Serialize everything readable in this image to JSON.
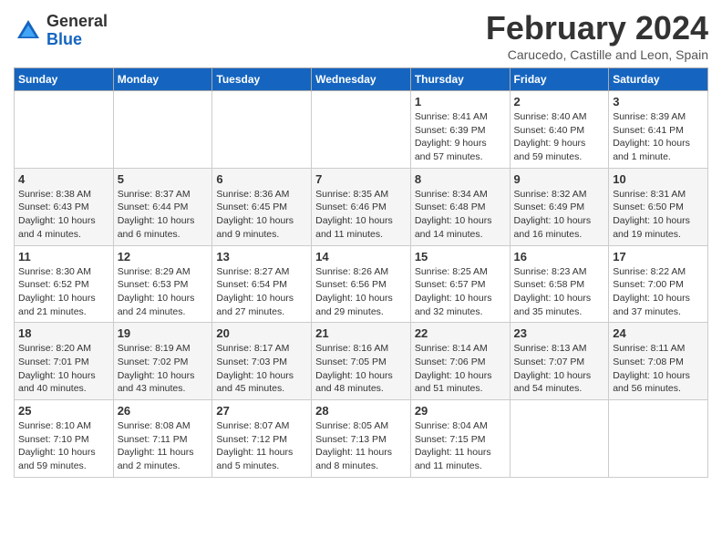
{
  "logo": {
    "general": "General",
    "blue": "Blue"
  },
  "title": "February 2024",
  "location": "Carucedo, Castille and Leon, Spain",
  "weekdays": [
    "Sunday",
    "Monday",
    "Tuesday",
    "Wednesday",
    "Thursday",
    "Friday",
    "Saturday"
  ],
  "weeks": [
    [
      {
        "day": "",
        "info": ""
      },
      {
        "day": "",
        "info": ""
      },
      {
        "day": "",
        "info": ""
      },
      {
        "day": "",
        "info": ""
      },
      {
        "day": "1",
        "info": "Sunrise: 8:41 AM\nSunset: 6:39 PM\nDaylight: 9 hours\nand 57 minutes."
      },
      {
        "day": "2",
        "info": "Sunrise: 8:40 AM\nSunset: 6:40 PM\nDaylight: 9 hours\nand 59 minutes."
      },
      {
        "day": "3",
        "info": "Sunrise: 8:39 AM\nSunset: 6:41 PM\nDaylight: 10 hours\nand 1 minute."
      }
    ],
    [
      {
        "day": "4",
        "info": "Sunrise: 8:38 AM\nSunset: 6:43 PM\nDaylight: 10 hours\nand 4 minutes."
      },
      {
        "day": "5",
        "info": "Sunrise: 8:37 AM\nSunset: 6:44 PM\nDaylight: 10 hours\nand 6 minutes."
      },
      {
        "day": "6",
        "info": "Sunrise: 8:36 AM\nSunset: 6:45 PM\nDaylight: 10 hours\nand 9 minutes."
      },
      {
        "day": "7",
        "info": "Sunrise: 8:35 AM\nSunset: 6:46 PM\nDaylight: 10 hours\nand 11 minutes."
      },
      {
        "day": "8",
        "info": "Sunrise: 8:34 AM\nSunset: 6:48 PM\nDaylight: 10 hours\nand 14 minutes."
      },
      {
        "day": "9",
        "info": "Sunrise: 8:32 AM\nSunset: 6:49 PM\nDaylight: 10 hours\nand 16 minutes."
      },
      {
        "day": "10",
        "info": "Sunrise: 8:31 AM\nSunset: 6:50 PM\nDaylight: 10 hours\nand 19 minutes."
      }
    ],
    [
      {
        "day": "11",
        "info": "Sunrise: 8:30 AM\nSunset: 6:52 PM\nDaylight: 10 hours\nand 21 minutes."
      },
      {
        "day": "12",
        "info": "Sunrise: 8:29 AM\nSunset: 6:53 PM\nDaylight: 10 hours\nand 24 minutes."
      },
      {
        "day": "13",
        "info": "Sunrise: 8:27 AM\nSunset: 6:54 PM\nDaylight: 10 hours\nand 27 minutes."
      },
      {
        "day": "14",
        "info": "Sunrise: 8:26 AM\nSunset: 6:56 PM\nDaylight: 10 hours\nand 29 minutes."
      },
      {
        "day": "15",
        "info": "Sunrise: 8:25 AM\nSunset: 6:57 PM\nDaylight: 10 hours\nand 32 minutes."
      },
      {
        "day": "16",
        "info": "Sunrise: 8:23 AM\nSunset: 6:58 PM\nDaylight: 10 hours\nand 35 minutes."
      },
      {
        "day": "17",
        "info": "Sunrise: 8:22 AM\nSunset: 7:00 PM\nDaylight: 10 hours\nand 37 minutes."
      }
    ],
    [
      {
        "day": "18",
        "info": "Sunrise: 8:20 AM\nSunset: 7:01 PM\nDaylight: 10 hours\nand 40 minutes."
      },
      {
        "day": "19",
        "info": "Sunrise: 8:19 AM\nSunset: 7:02 PM\nDaylight: 10 hours\nand 43 minutes."
      },
      {
        "day": "20",
        "info": "Sunrise: 8:17 AM\nSunset: 7:03 PM\nDaylight: 10 hours\nand 45 minutes."
      },
      {
        "day": "21",
        "info": "Sunrise: 8:16 AM\nSunset: 7:05 PM\nDaylight: 10 hours\nand 48 minutes."
      },
      {
        "day": "22",
        "info": "Sunrise: 8:14 AM\nSunset: 7:06 PM\nDaylight: 10 hours\nand 51 minutes."
      },
      {
        "day": "23",
        "info": "Sunrise: 8:13 AM\nSunset: 7:07 PM\nDaylight: 10 hours\nand 54 minutes."
      },
      {
        "day": "24",
        "info": "Sunrise: 8:11 AM\nSunset: 7:08 PM\nDaylight: 10 hours\nand 56 minutes."
      }
    ],
    [
      {
        "day": "25",
        "info": "Sunrise: 8:10 AM\nSunset: 7:10 PM\nDaylight: 10 hours\nand 59 minutes."
      },
      {
        "day": "26",
        "info": "Sunrise: 8:08 AM\nSunset: 7:11 PM\nDaylight: 11 hours\nand 2 minutes."
      },
      {
        "day": "27",
        "info": "Sunrise: 8:07 AM\nSunset: 7:12 PM\nDaylight: 11 hours\nand 5 minutes."
      },
      {
        "day": "28",
        "info": "Sunrise: 8:05 AM\nSunset: 7:13 PM\nDaylight: 11 hours\nand 8 minutes."
      },
      {
        "day": "29",
        "info": "Sunrise: 8:04 AM\nSunset: 7:15 PM\nDaylight: 11 hours\nand 11 minutes."
      },
      {
        "day": "",
        "info": ""
      },
      {
        "day": "",
        "info": ""
      }
    ]
  ]
}
